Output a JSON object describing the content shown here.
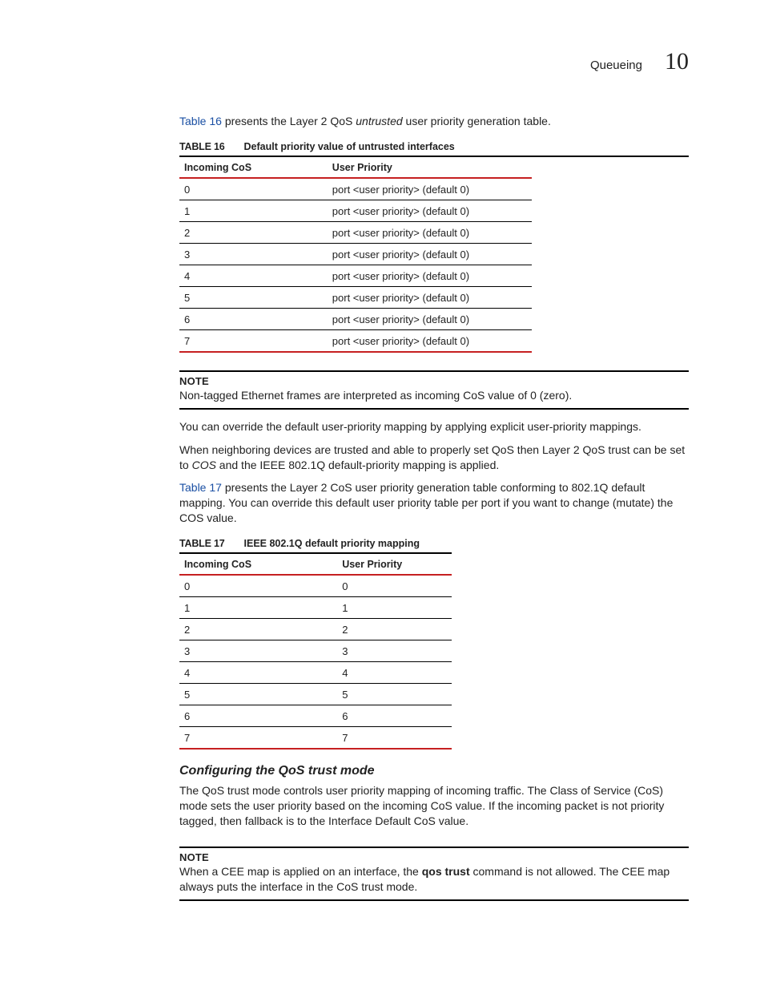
{
  "header": {
    "section": "Queueing",
    "chapter": "10"
  },
  "intro_para": {
    "ref": "Table 16",
    "text_after_ref": " presents the Layer 2 QoS ",
    "italic": "untrusted",
    "text_after_italic": " user priority generation table."
  },
  "table16": {
    "label": "TABLE 16",
    "caption": "Default priority value of untrusted interfaces",
    "col1": "Incoming CoS",
    "col2": "User Priority",
    "rows": [
      {
        "c": "0",
        "p": "port <user priority> (default 0)"
      },
      {
        "c": "1",
        "p": "port <user priority> (default 0)"
      },
      {
        "c": "2",
        "p": "port <user priority> (default 0)"
      },
      {
        "c": "3",
        "p": "port <user priority> (default 0)"
      },
      {
        "c": "4",
        "p": "port <user priority> (default 0)"
      },
      {
        "c": "5",
        "p": "port <user priority> (default 0)"
      },
      {
        "c": "6",
        "p": "port <user priority> (default 0)"
      },
      {
        "c": "7",
        "p": "port <user priority> (default 0)"
      }
    ]
  },
  "note1": {
    "label": "NOTE",
    "body": "Non-tagged Ethernet frames are interpreted as incoming CoS value of 0 (zero)."
  },
  "para2": "You can override the default user-priority mapping by applying explicit user-priority mappings.",
  "para3": {
    "before_italic": "When neighboring devices are trusted and able to properly set QoS then Layer 2 QoS trust can be set to ",
    "italic": "COS",
    "after_italic": " and the IEEE 802.1Q default-priority mapping is applied."
  },
  "para4": {
    "ref": "Table 17",
    "text": " presents the Layer 2 CoS user priority generation table conforming to 802.1Q default mapping. You can override this default user priority table per port if you want to change (mutate) the COS value."
  },
  "table17": {
    "label": "TABLE 17",
    "caption": "IEEE 802.1Q default priority mapping",
    "col1": "Incoming CoS",
    "col2": "User Priority",
    "rows": [
      {
        "c": "0",
        "p": "0"
      },
      {
        "c": "1",
        "p": "1"
      },
      {
        "c": "2",
        "p": "2"
      },
      {
        "c": "3",
        "p": "3"
      },
      {
        "c": "4",
        "p": "4"
      },
      {
        "c": "5",
        "p": "5"
      },
      {
        "c": "6",
        "p": "6"
      },
      {
        "c": "7",
        "p": "7"
      }
    ]
  },
  "subhead": "Configuring the QoS trust mode",
  "para5": "The QoS trust mode controls user priority mapping of incoming traffic. The Class of Service (CoS) mode sets the user priority based on the incoming CoS value. If the incoming packet is not priority tagged, then fallback is to the Interface Default CoS value.",
  "note2": {
    "label": "NOTE",
    "before_bold": "When a CEE map is applied on an interface, the ",
    "bold": "qos trust",
    "after_bold": " command is not allowed. The CEE map always puts the interface in the CoS trust mode."
  }
}
